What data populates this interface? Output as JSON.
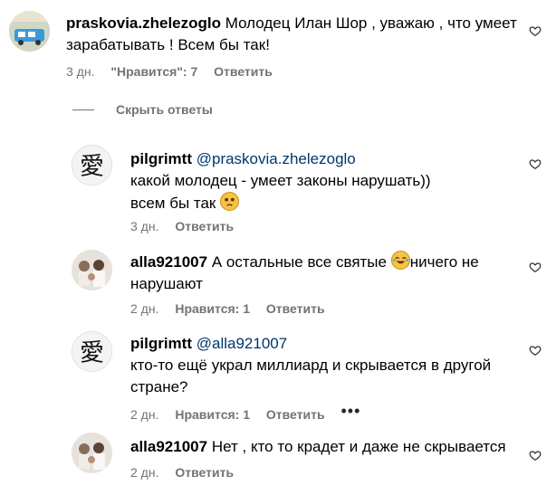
{
  "comments": [
    {
      "username": "praskovia.zhelezoglo",
      "text": "Молодец Илан Шор , уважаю , что умеет зарабатывать ! Всем бы так!",
      "time": "3 дн.",
      "likes": "\"Нравится\": 7",
      "reply": "Ответить"
    }
  ],
  "hide_replies": "Скрыть ответы",
  "replies": [
    {
      "username": "pilgrimtt",
      "mention": "@praskovia.zhelezoglo",
      "line1": "какой молодец - умеет законы нарушать))",
      "line2": "всем бы так",
      "time": "3 дн.",
      "reply": "Ответить",
      "emoji": "pleading-face-emoji"
    },
    {
      "username": "alla921007",
      "text_before": "А остальные все святые",
      "text_after": "ничего не",
      "line2": "нарушают",
      "time": "2 дн.",
      "likes": "Нравится: 1",
      "reply": "Ответить",
      "emoji": "laughing-tears-emoji"
    },
    {
      "username": "pilgrimtt",
      "mention": "@alla921007",
      "line1": "кто-то ещё украл миллиард и скрывается в другой",
      "line2": "стране?",
      "time": "2 дн.",
      "likes": "Нравится: 1",
      "reply": "Ответить",
      "more": "•••"
    },
    {
      "username": "alla921007",
      "text": "Нет , кто то крадет и даже не скрывается",
      "time": "2 дн.",
      "reply": "Ответить"
    }
  ],
  "icons": {
    "heart": "heart-outline-icon",
    "more": "more-options-icon"
  },
  "colors": {
    "mention": "#00376b",
    "meta": "#737373",
    "text": "#000000"
  }
}
